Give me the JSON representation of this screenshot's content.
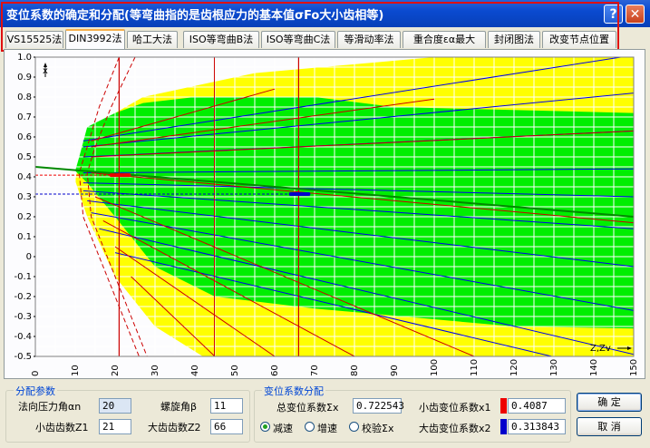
{
  "window": {
    "title": "变位系数的确定和分配(等弯曲指的是齿根应力的基本值σFo大小齿相等)",
    "help_label": "?",
    "close_label": "✕"
  },
  "tabs": [
    {
      "label": "VS15525法",
      "active": false
    },
    {
      "label": "DIN3992法",
      "active": true
    },
    {
      "label": "哈工大法",
      "active": false
    },
    {
      "label": "ISO等弯曲B法",
      "active": false
    },
    {
      "label": "ISO等弯曲C法",
      "active": false
    },
    {
      "label": "等滑动率法",
      "active": false
    },
    {
      "label": "重合度εα最大",
      "active": false
    },
    {
      "label": "封闭图法",
      "active": false
    },
    {
      "label": "改变节点位置",
      "active": false
    }
  ],
  "chart_data": {
    "type": "line",
    "xlabel": "Z,Zv",
    "ylabel": "x",
    "xlim": [
      0,
      150
    ],
    "ylim": [
      -0.5,
      1.0
    ],
    "x_ticks": [
      "0",
      "10",
      "20",
      "30",
      "40",
      "50",
      "60",
      "70",
      "80",
      "90",
      "100",
      "110",
      "120",
      "130",
      "140",
      "150"
    ],
    "y_ticks": [
      "1.0",
      "0.9",
      "0.8",
      "0.7",
      "0.6",
      "0.5",
      "0.4",
      "0.3",
      "0.2",
      "0.1",
      "0",
      "-0.1",
      "-0.2",
      "-0.3",
      "-0.4",
      "-0.5"
    ],
    "grid": true,
    "z1": 21,
    "z2": 66,
    "x1": 0.4087,
    "x2": 0.313843,
    "colors": {
      "yellow_zone": "#ffff00",
      "green_zone": "#00ee00",
      "blue_lines": "#0000ee",
      "red_lines": "#cc0000",
      "grid": "#ffffff",
      "x1_marker": "#ee0000",
      "x2_marker": "#0000cc"
    }
  },
  "distribution_params": {
    "title": "分配参数",
    "pressure_angle_label": "法向压力角αn",
    "pressure_angle_value": "20",
    "helix_angle_label": "螺旋角β",
    "helix_angle_value": "11",
    "z1_label": "小齿齿数Z1",
    "z1_value": "21",
    "z2_label": "大齿齿数Z2",
    "z2_value": "66"
  },
  "shift_distribution": {
    "title": "变位系数分配",
    "total_label": "总变位系数Σx",
    "total_value": "0.722543",
    "x1_label": "小齿变位系数x1",
    "x1_value": "0.4087",
    "x1_color": "#ee0000",
    "x2_label": "大齿变位系数x2",
    "x2_value": "0.313843",
    "x2_color": "#0000cc",
    "radios": [
      {
        "label": "减速",
        "checked": true
      },
      {
        "label": "增速",
        "checked": false
      },
      {
        "label": "校验Σx",
        "checked": false
      }
    ]
  },
  "buttons": {
    "ok": "确  定",
    "cancel": "取  消"
  }
}
